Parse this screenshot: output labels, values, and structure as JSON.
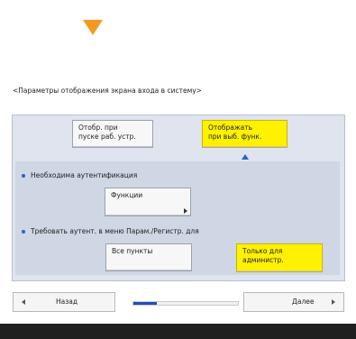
{
  "heading": "<Параметры отображения экрана входа в систему>",
  "display_timing": {
    "option_startup_line1": "Отобр. при",
    "option_startup_line2": "пуске раб. устр.",
    "option_function_line1": "Отображать",
    "option_function_line2": "при выб. функ."
  },
  "auth_required": {
    "label": "Необходима аутентификация",
    "functions_button": "Функции"
  },
  "settings_menu_auth": {
    "label": "Требовать аутент. в меню Парам./Регистр. для",
    "all_items": "Все пункты",
    "admin_only_line1": "Только для",
    "admin_only_line2": "администр."
  },
  "nav": {
    "back": "Назад",
    "next": "Далее",
    "progress_fraction": 0.22
  },
  "colors": {
    "selected": "#fff100",
    "accent": "#2a62c7",
    "arrow": "#f29a1f"
  }
}
